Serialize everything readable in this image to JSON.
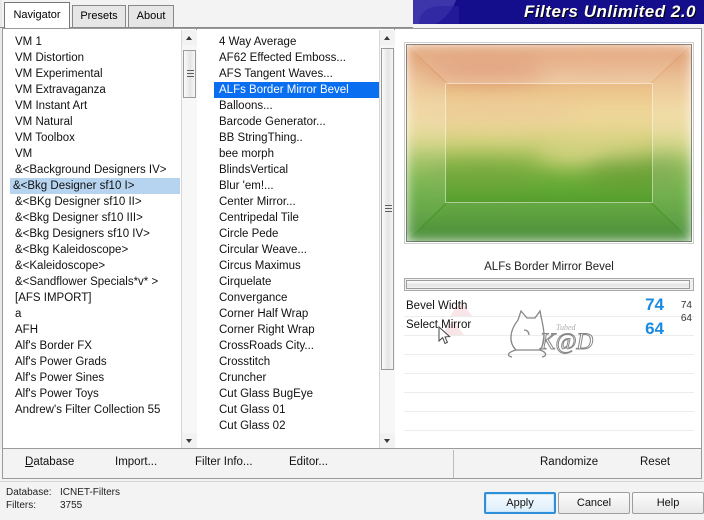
{
  "window": {
    "title": "Filters Unlimited 2.0"
  },
  "tabs": [
    {
      "label": "Navigator",
      "active": true
    },
    {
      "label": "Presets",
      "active": false
    },
    {
      "label": "About",
      "active": false
    }
  ],
  "category_list": {
    "items": [
      "VM 1",
      "VM Distortion",
      "VM Experimental",
      "VM Extravaganza",
      "VM Instant Art",
      "VM Natural",
      "VM Toolbox",
      "VM",
      "&<Background Designers IV>",
      "&<Bkg Designer sf10 I>",
      "&<BKg Designer sf10 II>",
      "&<Bkg Designer sf10 III>",
      "&<Bkg Designers sf10 IV>",
      "&<Bkg Kaleidoscope>",
      "&<Kaleidoscope>",
      "&<Sandflower Specials*v* >",
      "[AFS IMPORT]",
      "a",
      "AFH",
      "Alf's Border FX",
      "Alf's Power Grads",
      "Alf's Power Sines",
      "Alf's Power Toys",
      "Andrew's Filter Collection 55"
    ],
    "selected_index": 9
  },
  "filter_list": {
    "items": [
      "4 Way Average",
      "AF62 Effected Emboss...",
      "AFS Tangent Waves...",
      "ALFs Border Mirror Bevel",
      "Balloons...",
      "Barcode Generator...",
      "BB StringThing..",
      "bee morph",
      "BlindsVertical",
      "Blur 'em!...",
      "Center Mirror...",
      "Centripedal Tile",
      "Circle Pede",
      "Circular Weave...",
      "Circus Maximus",
      "Cirquelate",
      "Convergance",
      "Corner Half Wrap",
      "Corner Right Wrap",
      "CrossRoads City...",
      "Crosstitch",
      "Cruncher",
      "Cut Glass  BugEye",
      "Cut Glass 01",
      "Cut Glass 02"
    ],
    "selected_index": 3
  },
  "preview": {
    "filter_name": "ALFs Border Mirror Bevel",
    "watermark": "K@D",
    "watermark_small": "Tubed"
  },
  "parameters": [
    {
      "label": "Bevel Width",
      "value": "74",
      "value_small": "74"
    },
    {
      "label": "Select Mirror",
      "value": "64",
      "value_small": "64"
    }
  ],
  "menu": {
    "items": [
      {
        "label": "Database",
        "accel": "D"
      },
      {
        "label": "Import...",
        "accel": "I"
      },
      {
        "label": "Filter Info...",
        "accel": "I"
      },
      {
        "label": "Editor...",
        "accel": "E"
      }
    ],
    "right_items": [
      {
        "label": "Randomize"
      },
      {
        "label": "Reset"
      }
    ]
  },
  "status": {
    "database_label": "Database:",
    "database_value": "ICNET-Filters",
    "filters_label": "Filters:",
    "filters_value": "3755"
  },
  "actions": [
    {
      "label": "Apply",
      "focused": true
    },
    {
      "label": "Cancel",
      "focused": false
    },
    {
      "label": "Help",
      "focused": false
    }
  ],
  "colors": {
    "banner_bg": "#140e8c",
    "selection_hard": "#0a6ef0",
    "selection_soft": "#b6d4f0",
    "value_blue": "#1a8ae0"
  }
}
